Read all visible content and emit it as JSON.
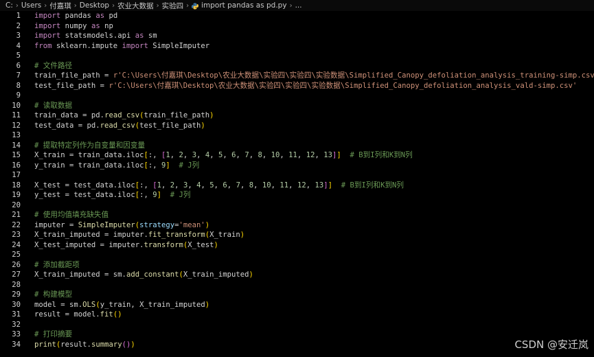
{
  "breadcrumb": {
    "items": [
      "C:",
      "Users",
      "付嘉琪",
      "Desktop",
      "农业大数据",
      "实验四",
      "import pandas as pd.py",
      "..."
    ]
  },
  "lines": [
    {
      "n": "1",
      "t": [
        [
          "kw",
          "import"
        ],
        [
          "id",
          " pandas "
        ],
        [
          "kw",
          "as"
        ],
        [
          "id",
          " pd"
        ]
      ]
    },
    {
      "n": "2",
      "t": [
        [
          "kw",
          "import"
        ],
        [
          "id",
          " numpy "
        ],
        [
          "kw",
          "as"
        ],
        [
          "id",
          " np"
        ]
      ]
    },
    {
      "n": "3",
      "t": [
        [
          "kw",
          "import"
        ],
        [
          "id",
          " statsmodels.api "
        ],
        [
          "kw",
          "as"
        ],
        [
          "id",
          " sm"
        ]
      ]
    },
    {
      "n": "4",
      "t": [
        [
          "kw",
          "from"
        ],
        [
          "id",
          " sklearn.impute "
        ],
        [
          "kw",
          "import"
        ],
        [
          "id",
          " SimpleImputer"
        ]
      ]
    },
    {
      "n": "5",
      "t": []
    },
    {
      "n": "6",
      "t": [
        [
          "cm",
          "# 文件路径"
        ]
      ]
    },
    {
      "n": "7",
      "t": [
        [
          "id",
          "train_file_path = "
        ],
        [
          "str",
          "r'C:\\Users\\付嘉琪\\Desktop\\农业大数据\\实验四\\实验四\\实验数据\\Simplified_Canopy_defoliation_analysis_training-simp.csv'"
        ]
      ]
    },
    {
      "n": "8",
      "t": [
        [
          "id",
          "test_file_path = "
        ],
        [
          "str",
          "r'C:\\Users\\付嘉琪\\Desktop\\农业大数据\\实验四\\实验四\\实验数据\\Simplified_Canopy_defoliation_analysis_vald-simp.csv'"
        ]
      ]
    },
    {
      "n": "9",
      "t": []
    },
    {
      "n": "10",
      "t": [
        [
          "cm",
          "# 读取数据"
        ]
      ]
    },
    {
      "n": "11",
      "t": [
        [
          "id",
          "train_data = pd."
        ],
        [
          "fn",
          "read_csv"
        ],
        [
          "b1",
          "("
        ],
        [
          "id",
          "train_file_path"
        ],
        [
          "b1",
          ")"
        ]
      ]
    },
    {
      "n": "12",
      "t": [
        [
          "id",
          "test_data = pd."
        ],
        [
          "fn",
          "read_csv"
        ],
        [
          "b1",
          "("
        ],
        [
          "id",
          "test_file_path"
        ],
        [
          "b1",
          ")"
        ]
      ]
    },
    {
      "n": "13",
      "t": []
    },
    {
      "n": "14",
      "t": [
        [
          "cm",
          "# 提取特定列作为自变量和因变量"
        ]
      ]
    },
    {
      "n": "15",
      "t": [
        [
          "id",
          "X_train = train_data.iloc"
        ],
        [
          "b1",
          "["
        ],
        [
          "id",
          ":, "
        ],
        [
          "b2",
          "["
        ],
        [
          "num",
          "1"
        ],
        [
          "id",
          ", "
        ],
        [
          "num",
          "2"
        ],
        [
          "id",
          ", "
        ],
        [
          "num",
          "3"
        ],
        [
          "id",
          ", "
        ],
        [
          "num",
          "4"
        ],
        [
          "id",
          ", "
        ],
        [
          "num",
          "5"
        ],
        [
          "id",
          ", "
        ],
        [
          "num",
          "6"
        ],
        [
          "id",
          ", "
        ],
        [
          "num",
          "7"
        ],
        [
          "id",
          ", "
        ],
        [
          "num",
          "8"
        ],
        [
          "id",
          ", "
        ],
        [
          "num",
          "10"
        ],
        [
          "id",
          ", "
        ],
        [
          "num",
          "11"
        ],
        [
          "id",
          ", "
        ],
        [
          "num",
          "12"
        ],
        [
          "id",
          ", "
        ],
        [
          "num",
          "13"
        ],
        [
          "b2",
          "]"
        ],
        [
          "b1",
          "]"
        ],
        [
          "id",
          "  "
        ],
        [
          "cm",
          "# B到I列和K到N列"
        ]
      ]
    },
    {
      "n": "16",
      "t": [
        [
          "id",
          "y_train = train_data.iloc"
        ],
        [
          "b1",
          "["
        ],
        [
          "id",
          ":, "
        ],
        [
          "num",
          "9"
        ],
        [
          "b1",
          "]"
        ],
        [
          "id",
          "  "
        ],
        [
          "cm",
          "# J列"
        ]
      ]
    },
    {
      "n": "17",
      "t": []
    },
    {
      "n": "18",
      "t": [
        [
          "id",
          "X_test = test_data.iloc"
        ],
        [
          "b1",
          "["
        ],
        [
          "id",
          ":, "
        ],
        [
          "b2",
          "["
        ],
        [
          "num",
          "1"
        ],
        [
          "id",
          ", "
        ],
        [
          "num",
          "2"
        ],
        [
          "id",
          ", "
        ],
        [
          "num",
          "3"
        ],
        [
          "id",
          ", "
        ],
        [
          "num",
          "4"
        ],
        [
          "id",
          ", "
        ],
        [
          "num",
          "5"
        ],
        [
          "id",
          ", "
        ],
        [
          "num",
          "6"
        ],
        [
          "id",
          ", "
        ],
        [
          "num",
          "7"
        ],
        [
          "id",
          ", "
        ],
        [
          "num",
          "8"
        ],
        [
          "id",
          ", "
        ],
        [
          "num",
          "10"
        ],
        [
          "id",
          ", "
        ],
        [
          "num",
          "11"
        ],
        [
          "id",
          ", "
        ],
        [
          "num",
          "12"
        ],
        [
          "id",
          ", "
        ],
        [
          "num",
          "13"
        ],
        [
          "b2",
          "]"
        ],
        [
          "b1",
          "]"
        ],
        [
          "id",
          "  "
        ],
        [
          "cm",
          "# B到I列和K到N列"
        ]
      ]
    },
    {
      "n": "19",
      "t": [
        [
          "id",
          "y_test = test_data.iloc"
        ],
        [
          "b1",
          "["
        ],
        [
          "id",
          ":, "
        ],
        [
          "num",
          "9"
        ],
        [
          "b1",
          "]"
        ],
        [
          "id",
          "  "
        ],
        [
          "cm",
          "# J列"
        ]
      ]
    },
    {
      "n": "20",
      "t": []
    },
    {
      "n": "21",
      "t": [
        [
          "cm",
          "# 使用均值填充缺失值"
        ]
      ]
    },
    {
      "n": "22",
      "t": [
        [
          "id",
          "imputer = "
        ],
        [
          "fn",
          "SimpleImputer"
        ],
        [
          "b1",
          "("
        ],
        [
          "param",
          "strategy"
        ],
        [
          "id",
          "="
        ],
        [
          "str",
          "'mean'"
        ],
        [
          "b1",
          ")"
        ]
      ]
    },
    {
      "n": "23",
      "t": [
        [
          "id",
          "X_train_imputed = imputer."
        ],
        [
          "fn",
          "fit_transform"
        ],
        [
          "b1",
          "("
        ],
        [
          "id",
          "X_train"
        ],
        [
          "b1",
          ")"
        ]
      ]
    },
    {
      "n": "24",
      "t": [
        [
          "id",
          "X_test_imputed = imputer."
        ],
        [
          "fn",
          "transform"
        ],
        [
          "b1",
          "("
        ],
        [
          "id",
          "X_test"
        ],
        [
          "b1",
          ")"
        ]
      ]
    },
    {
      "n": "25",
      "t": []
    },
    {
      "n": "26",
      "t": [
        [
          "cm",
          "# 添加截距项"
        ]
      ]
    },
    {
      "n": "27",
      "t": [
        [
          "id",
          "X_train_imputed = sm."
        ],
        [
          "fn",
          "add_constant"
        ],
        [
          "b1",
          "("
        ],
        [
          "id",
          "X_train_imputed"
        ],
        [
          "b1",
          ")"
        ]
      ]
    },
    {
      "n": "28",
      "t": []
    },
    {
      "n": "29",
      "t": [
        [
          "cm",
          "# 构建模型"
        ]
      ]
    },
    {
      "n": "30",
      "t": [
        [
          "id",
          "model = sm."
        ],
        [
          "fn",
          "OLS"
        ],
        [
          "b1",
          "("
        ],
        [
          "id",
          "y_train, X_train_imputed"
        ],
        [
          "b1",
          ")"
        ]
      ]
    },
    {
      "n": "31",
      "t": [
        [
          "id",
          "result = model."
        ],
        [
          "fn",
          "fit"
        ],
        [
          "b1",
          "("
        ],
        [
          "b1",
          ")"
        ]
      ]
    },
    {
      "n": "32",
      "t": []
    },
    {
      "n": "33",
      "t": [
        [
          "cm",
          "# 打印摘要"
        ]
      ]
    },
    {
      "n": "34",
      "t": [
        [
          "fn",
          "print"
        ],
        [
          "b1",
          "("
        ],
        [
          "id",
          "result."
        ],
        [
          "fn",
          "summary"
        ],
        [
          "b2",
          "("
        ],
        [
          "b2",
          ")"
        ],
        [
          "b1",
          ")"
        ]
      ]
    }
  ],
  "watermark": "CSDN @安迁岚"
}
